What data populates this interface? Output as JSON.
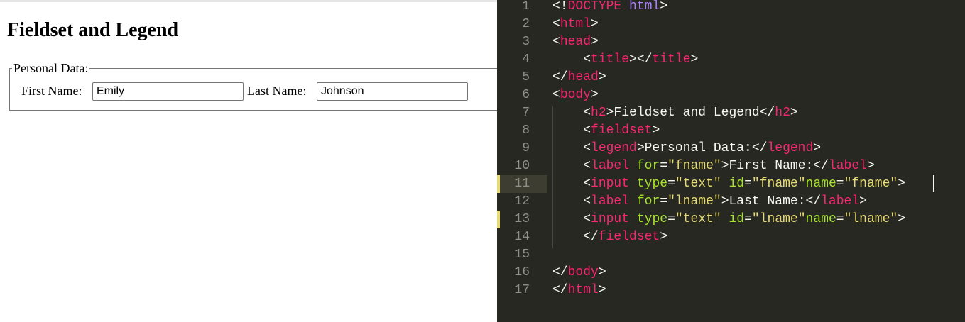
{
  "preview": {
    "heading": "Fieldset and Legend",
    "legend": "Personal Data:",
    "first_name_label": "First Name:",
    "first_name_value": "Emily",
    "last_name_label": "Last Name:",
    "last_name_value": "Johnson"
  },
  "editor": {
    "active_line": 11,
    "modified_lines": [
      11,
      13
    ],
    "lines": [
      {
        "num": "1",
        "tokens": [
          [
            "<!",
            "punct"
          ],
          [
            "DOCTYPE",
            "doctype"
          ],
          [
            " ",
            "text"
          ],
          [
            "html",
            "html-kw"
          ],
          [
            ">",
            "punct"
          ]
        ]
      },
      {
        "num": "2",
        "tokens": [
          [
            "<",
            "punct"
          ],
          [
            "html",
            "tag"
          ],
          [
            ">",
            "punct"
          ]
        ]
      },
      {
        "num": "3",
        "tokens": [
          [
            "<",
            "punct"
          ],
          [
            "head",
            "tag"
          ],
          [
            ">",
            "punct"
          ]
        ]
      },
      {
        "num": "4",
        "tokens": [
          [
            "    <",
            "punct"
          ],
          [
            "title",
            "tag"
          ],
          [
            "></",
            "punct"
          ],
          [
            "title",
            "tag"
          ],
          [
            ">",
            "punct"
          ]
        ]
      },
      {
        "num": "5",
        "tokens": [
          [
            "</",
            "punct"
          ],
          [
            "head",
            "tag"
          ],
          [
            ">",
            "punct"
          ]
        ]
      },
      {
        "num": "6",
        "tokens": [
          [
            "<",
            "punct"
          ],
          [
            "body",
            "tag"
          ],
          [
            ">",
            "punct"
          ]
        ]
      },
      {
        "num": "7",
        "tokens": [
          [
            "    <",
            "punct"
          ],
          [
            "h2",
            "tag"
          ],
          [
            ">Fieldset and Legend</",
            "text"
          ],
          [
            "h2",
            "tag"
          ],
          [
            ">",
            "punct"
          ]
        ]
      },
      {
        "num": "8",
        "tokens": [
          [
            "    <",
            "punct"
          ],
          [
            "fieldset",
            "tag"
          ],
          [
            ">",
            "punct"
          ]
        ]
      },
      {
        "num": "9",
        "tokens": [
          [
            "    <",
            "punct"
          ],
          [
            "legend",
            "tag"
          ],
          [
            ">Personal Data:</",
            "text"
          ],
          [
            "legend",
            "tag"
          ],
          [
            ">",
            "punct"
          ]
        ]
      },
      {
        "num": "10",
        "tokens": [
          [
            "    <",
            "punct"
          ],
          [
            "label",
            "tag"
          ],
          [
            " ",
            "text"
          ],
          [
            "for",
            "attr"
          ],
          [
            "=",
            "punct"
          ],
          [
            "\"fname\"",
            "str"
          ],
          [
            ">First Name:</",
            "text"
          ],
          [
            "label",
            "tag"
          ],
          [
            ">",
            "punct"
          ]
        ]
      },
      {
        "num": "11",
        "tokens": [
          [
            "    <",
            "punct"
          ],
          [
            "input",
            "tag"
          ],
          [
            " ",
            "text"
          ],
          [
            "type",
            "attr"
          ],
          [
            "=",
            "punct"
          ],
          [
            "\"text\"",
            "str"
          ],
          [
            " ",
            "text"
          ],
          [
            "id",
            "attr"
          ],
          [
            "=",
            "punct"
          ],
          [
            "\"fname\"",
            "str"
          ],
          [
            "name",
            "attr"
          ],
          [
            "=",
            "punct"
          ],
          [
            "\"fname\"",
            "str"
          ],
          [
            ">",
            "punct"
          ]
        ]
      },
      {
        "num": "12",
        "tokens": [
          [
            "    <",
            "punct"
          ],
          [
            "label",
            "tag"
          ],
          [
            " ",
            "text"
          ],
          [
            "for",
            "attr"
          ],
          [
            "=",
            "punct"
          ],
          [
            "\"lname\"",
            "str"
          ],
          [
            ">Last Name:</",
            "text"
          ],
          [
            "label",
            "tag"
          ],
          [
            ">",
            "punct"
          ]
        ]
      },
      {
        "num": "13",
        "tokens": [
          [
            "    <",
            "punct"
          ],
          [
            "input",
            "tag"
          ],
          [
            " ",
            "text"
          ],
          [
            "type",
            "attr"
          ],
          [
            "=",
            "punct"
          ],
          [
            "\"text\"",
            "str"
          ],
          [
            " ",
            "text"
          ],
          [
            "id",
            "attr"
          ],
          [
            "=",
            "punct"
          ],
          [
            "\"lname\"",
            "str"
          ],
          [
            "name",
            "attr"
          ],
          [
            "=",
            "punct"
          ],
          [
            "\"lname\"",
            "str"
          ],
          [
            ">",
            "punct"
          ]
        ]
      },
      {
        "num": "14",
        "tokens": [
          [
            "    </",
            "punct"
          ],
          [
            "fieldset",
            "tag"
          ],
          [
            ">",
            "punct"
          ]
        ]
      },
      {
        "num": "15",
        "tokens": []
      },
      {
        "num": "16",
        "tokens": [
          [
            "</",
            "punct"
          ],
          [
            "body",
            "tag"
          ],
          [
            ">",
            "punct"
          ]
        ]
      },
      {
        "num": "17",
        "tokens": [
          [
            "</",
            "punct"
          ],
          [
            "html",
            "tag"
          ],
          [
            ">",
            "punct"
          ]
        ]
      }
    ]
  },
  "colors": {
    "editor_bg": "#272822",
    "tag": "#f92672",
    "attribute": "#a6e22e",
    "string": "#e6db74",
    "keyword": "#ae81ff",
    "text": "#f8f8f2",
    "line_number": "#8f908a",
    "modified_marker": "#e6db74"
  }
}
